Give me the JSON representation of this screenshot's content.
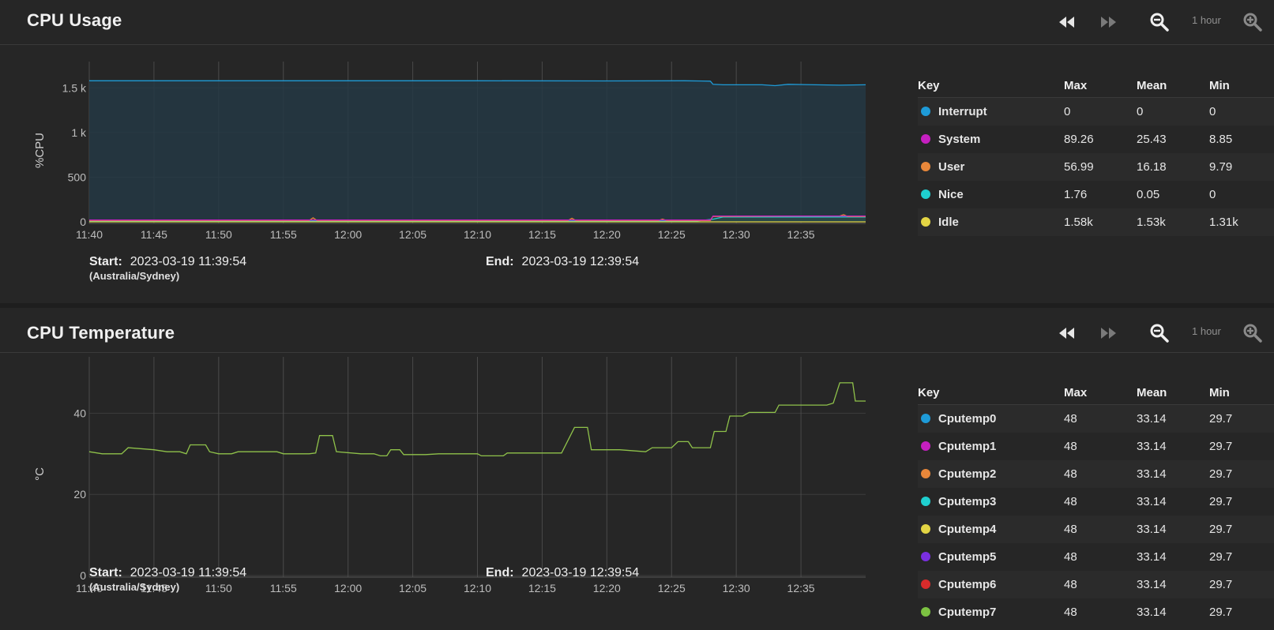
{
  "panels": [
    {
      "title": "CPU Usage",
      "zoom_label": "1 hour",
      "start_label": "Start:",
      "start_value": "2023-03-19 11:39:54",
      "timezone": "(Australia/Sydney)",
      "end_label": "End:",
      "end_value": "2023-03-19 12:39:54",
      "legend_headers": [
        "Key",
        "Max",
        "Mean",
        "Min"
      ],
      "legend": [
        {
          "name": "Interrupt",
          "max": "0",
          "mean": "0",
          "min": "0",
          "color": "#1e9bd8"
        },
        {
          "name": "System",
          "max": "89.26",
          "mean": "25.43",
          "min": "8.85",
          "color": "#c51fc0"
        },
        {
          "name": "User",
          "max": "56.99",
          "mean": "16.18",
          "min": "9.79",
          "color": "#e8873a"
        },
        {
          "name": "Nice",
          "max": "1.76",
          "mean": "0.05",
          "min": "0",
          "color": "#1fcfcf"
        },
        {
          "name": "Idle",
          "max": "1.58k",
          "mean": "1.53k",
          "min": "1.31k",
          "color": "#e3d544"
        }
      ]
    },
    {
      "title": "CPU Temperature",
      "zoom_label": "1 hour",
      "start_label": "Start:",
      "start_value": "2023-03-19 11:39:54",
      "timezone": "(Australia/Sydney)",
      "end_label": "End:",
      "end_value": "2023-03-19 12:39:54",
      "legend_headers": [
        "Key",
        "Max",
        "Mean",
        "Min"
      ],
      "legend": [
        {
          "name": "Cputemp0",
          "max": "48",
          "mean": "33.14",
          "min": "29.7",
          "color": "#1e9bd8"
        },
        {
          "name": "Cputemp1",
          "max": "48",
          "mean": "33.14",
          "min": "29.7",
          "color": "#c51fc0"
        },
        {
          "name": "Cputemp2",
          "max": "48",
          "mean": "33.14",
          "min": "29.7",
          "color": "#e8873a"
        },
        {
          "name": "Cputemp3",
          "max": "48",
          "mean": "33.14",
          "min": "29.7",
          "color": "#1fcfcf"
        },
        {
          "name": "Cputemp4",
          "max": "48",
          "mean": "33.14",
          "min": "29.7",
          "color": "#e3d544"
        },
        {
          "name": "Cputemp5",
          "max": "48",
          "mean": "33.14",
          "min": "29.7",
          "color": "#7a2fe0"
        },
        {
          "name": "Cputemp6",
          "max": "48",
          "mean": "33.14",
          "min": "29.7",
          "color": "#d92b2b"
        },
        {
          "name": "Cputemp7",
          "max": "48",
          "mean": "33.14",
          "min": "29.7",
          "color": "#7cc242"
        }
      ]
    }
  ],
  "chart_data": [
    {
      "type": "area",
      "ylabel": "%CPU",
      "ylim": [
        0,
        1600
      ],
      "yticks": [
        {
          "v": 0,
          "label": "0"
        },
        {
          "v": 500,
          "label": "500"
        },
        {
          "v": 1000,
          "label": "1 k"
        },
        {
          "v": 1500,
          "label": "1.5 k"
        }
      ],
      "xlim_minutes": [
        0,
        60
      ],
      "xticks": [
        "11:40",
        "11:45",
        "11:50",
        "11:55",
        "12:00",
        "12:05",
        "12:10",
        "12:15",
        "12:20",
        "12:25",
        "12:30",
        "12:35"
      ],
      "grid": true,
      "series": [
        {
          "name": "Idle",
          "color": "#1e9bd8",
          "fill": "#243844",
          "points": [
            [
              0,
              1580
            ],
            [
              10,
              1580
            ],
            [
              20,
              1580
            ],
            [
              30,
              1580
            ],
            [
              40,
              1578
            ],
            [
              46,
              1580
            ],
            [
              48,
              1575
            ],
            [
              48.2,
              1540
            ],
            [
              49,
              1535
            ],
            [
              52,
              1535
            ],
            [
              53,
              1525
            ],
            [
              54,
              1540
            ],
            [
              58,
              1530
            ],
            [
              60,
              1535
            ]
          ]
        },
        {
          "name": "Nice",
          "color": "#1fcfcf",
          "fill": "#2a4a4a",
          "points": [
            [
              0,
              10
            ],
            [
              47,
              10
            ],
            [
              48.2,
              30
            ],
            [
              49,
              55
            ],
            [
              60,
              55
            ]
          ]
        },
        {
          "name": "User",
          "color": "#e8873a",
          "points": [
            [
              0,
              15
            ],
            [
              17,
              15
            ],
            [
              17.3,
              45
            ],
            [
              17.6,
              15
            ],
            [
              37,
              15
            ],
            [
              37.3,
              40
            ],
            [
              37.6,
              15
            ],
            [
              44,
              15
            ],
            [
              44.3,
              30
            ],
            [
              44.6,
              15
            ],
            [
              48,
              15
            ],
            [
              48.2,
              60
            ],
            [
              60,
              60
            ],
            [
              58,
              65
            ],
            [
              58.3,
              80
            ],
            [
              58.6,
              60
            ],
            [
              60,
              60
            ]
          ]
        },
        {
          "name": "System",
          "color": "#c51fc0",
          "points": [
            [
              0,
              20
            ],
            [
              48,
              20
            ],
            [
              48.2,
              65
            ],
            [
              60,
              65
            ]
          ]
        },
        {
          "name": "Interrupt",
          "color": "#e3d544",
          "points": [
            [
              0,
              0
            ],
            [
              60,
              0
            ]
          ]
        }
      ]
    },
    {
      "type": "line",
      "ylabel": "°C",
      "ylim": [
        0,
        50
      ],
      "yticks": [
        {
          "v": 0,
          "label": "0"
        },
        {
          "v": 20,
          "label": "20"
        },
        {
          "v": 40,
          "label": "40"
        }
      ],
      "xlim_minutes": [
        0,
        60
      ],
      "xticks": [
        "11:40",
        "11:45",
        "11:50",
        "11:55",
        "12:00",
        "12:05",
        "12:10",
        "12:15",
        "12:20",
        "12:25",
        "12:30",
        "12:35"
      ],
      "grid": true,
      "series": [
        {
          "name": "Cputemp7",
          "color": "#8fc24a",
          "points": [
            [
              0,
              30.5
            ],
            [
              1,
              30
            ],
            [
              2.5,
              30
            ],
            [
              3,
              31.5
            ],
            [
              5,
              31
            ],
            [
              6,
              30.5
            ],
            [
              7,
              30.5
            ],
            [
              7.5,
              30
            ],
            [
              7.8,
              32.2
            ],
            [
              9,
              32.2
            ],
            [
              9.3,
              30.5
            ],
            [
              10,
              30
            ],
            [
              11,
              30
            ],
            [
              11.5,
              30.5
            ],
            [
              14.5,
              30.5
            ],
            [
              15,
              30
            ],
            [
              17,
              30
            ],
            [
              17.5,
              30.2
            ],
            [
              17.8,
              34.5
            ],
            [
              18.8,
              34.5
            ],
            [
              19.1,
              30.5
            ],
            [
              21,
              30
            ],
            [
              22,
              30
            ],
            [
              22.5,
              29.5
            ],
            [
              23,
              29.5
            ],
            [
              23.3,
              31
            ],
            [
              24,
              31
            ],
            [
              24.3,
              29.8
            ],
            [
              26,
              29.8
            ],
            [
              27,
              30
            ],
            [
              30,
              30
            ],
            [
              30.3,
              29.5
            ],
            [
              32,
              29.5
            ],
            [
              32.3,
              30.2
            ],
            [
              34.5,
              30.2
            ],
            [
              35,
              30.2
            ],
            [
              36.5,
              30.2
            ],
            [
              37.5,
              36.5
            ],
            [
              38.5,
              36.5
            ],
            [
              38.8,
              31
            ],
            [
              41,
              31
            ],
            [
              43,
              30.5
            ],
            [
              43.5,
              31.5
            ],
            [
              45,
              31.5
            ],
            [
              45.5,
              33
            ],
            [
              46.3,
              33
            ],
            [
              46.6,
              31.5
            ],
            [
              48,
              31.5
            ],
            [
              48.3,
              35.5
            ],
            [
              49.2,
              35.5
            ],
            [
              49.5,
              39.3
            ],
            [
              50.5,
              39.3
            ],
            [
              51,
              40.2
            ],
            [
              53,
              40.2
            ],
            [
              53.3,
              42
            ],
            [
              57,
              42
            ],
            [
              57.5,
              42.5
            ],
            [
              58,
              47.5
            ],
            [
              59,
              47.5
            ],
            [
              59.2,
              43
            ],
            [
              60,
              43
            ]
          ]
        }
      ]
    }
  ]
}
